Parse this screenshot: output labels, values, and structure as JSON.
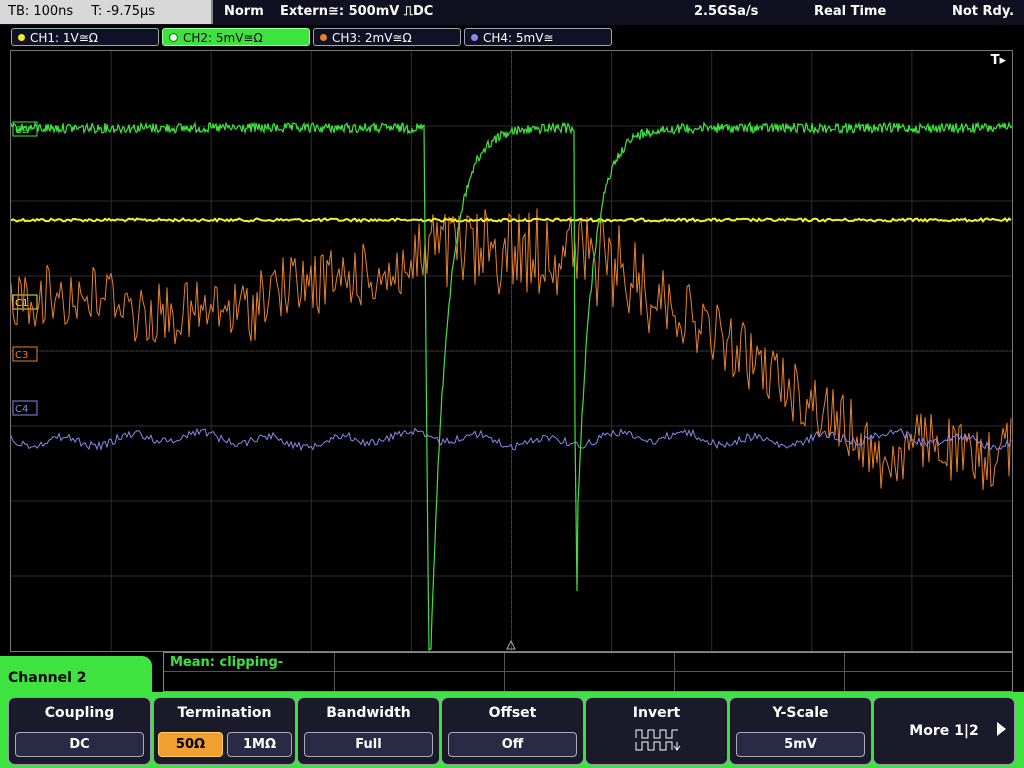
{
  "status": {
    "timebase": "TB: 100ns",
    "trigger_time": "T: -9.75µs",
    "mode": "Norm",
    "trigger_source": "Extern≅: 500mV ⎍DC",
    "sample_rate": "2.5GSa/s",
    "acq_mode": "Real Time",
    "ready_state": "Not Rdy."
  },
  "channels": [
    {
      "label": "CH1: 1V≅Ω",
      "color": "#f4ef2c",
      "active": false
    },
    {
      "label": "CH2: 5mV≅Ω",
      "color": "#3fe33f",
      "active": true
    },
    {
      "label": "CH3: 2mV≅Ω",
      "color": "#e8812c",
      "active": false
    },
    {
      "label": "CH4: 5mV≅",
      "color": "#8a86ea",
      "active": false
    }
  ],
  "screen": {
    "trigger_marker": "T▸",
    "markers": {
      "c1": "C1",
      "c2": "C2",
      "c3": "C3",
      "c4": "C4"
    }
  },
  "measurement": {
    "text": "Mean: clipping-"
  },
  "menu": {
    "title": "Channel 2",
    "coupling": {
      "title": "Coupling",
      "value": "DC"
    },
    "termination": {
      "title": "Termination",
      "option1": "50Ω",
      "option2": "1MΩ"
    },
    "bandwidth": {
      "title": "Bandwidth",
      "value": "Full"
    },
    "offset": {
      "title": "Offset",
      "value": "Off"
    },
    "invert": {
      "title": "Invert"
    },
    "yscale": {
      "title": "Y-Scale",
      "value": "5mV"
    },
    "more": {
      "label": "More 1|2"
    }
  }
}
